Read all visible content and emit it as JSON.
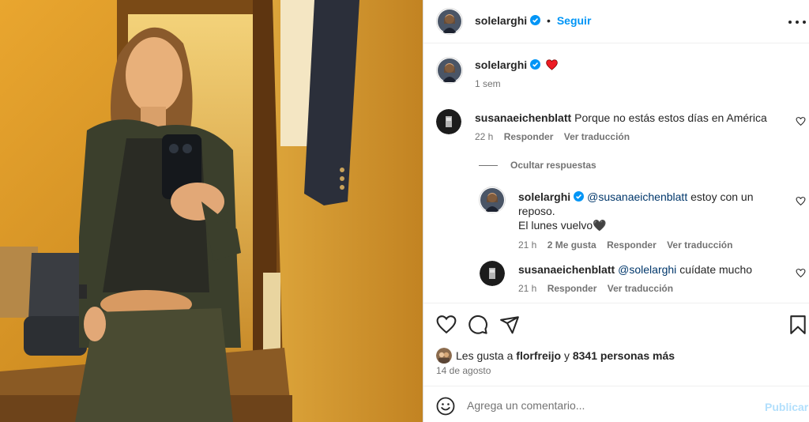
{
  "post": {
    "author": "solelarghi",
    "follow_label": "Seguir",
    "separator": "•",
    "more_icon": "more-options-icon",
    "verified_color": "#0095f6"
  },
  "caption": {
    "author": "solelarghi",
    "emoji": "❤️",
    "time": "1 sem"
  },
  "comments": [
    {
      "user": "susanaeichenblatt",
      "text": "Porque no estás estos días en América",
      "time": "22 h",
      "reply_label": "Responder",
      "translate_label": "Ver traducción",
      "hide_replies_label": "Ocultar respuestas",
      "replies": [
        {
          "user": "solelarghi",
          "mention": "@susanaeichenblatt",
          "text_line1": "estoy con un",
          "text_line2": "reposo.",
          "text_line3": "El lunes vuelvo🖤",
          "time": "21 h",
          "likes": "2 Me gusta",
          "reply_label": "Responder",
          "translate_label": "Ver traducción"
        },
        {
          "user": "susanaeichenblatt",
          "mention": "@solelarghi",
          "text": "cuídate mucho",
          "time": "21 h",
          "reply_label": "Responder",
          "translate_label": "Ver traducción"
        }
      ]
    }
  ],
  "engagement": {
    "likes_prefix": "Les gusta a",
    "liked_by": "florfreijo",
    "likes_joiner": "y",
    "others": "8341 personas más",
    "date": "14 de agosto"
  },
  "composer": {
    "placeholder": "Agrega un comentario...",
    "publish_label": "Publicar",
    "publish_color": "#b2dffc"
  },
  "colors": {
    "link_blue": "#0095f6",
    "mention_blue": "#00376b",
    "heart_red": "#ed1c24",
    "muted_text": "#737373"
  }
}
